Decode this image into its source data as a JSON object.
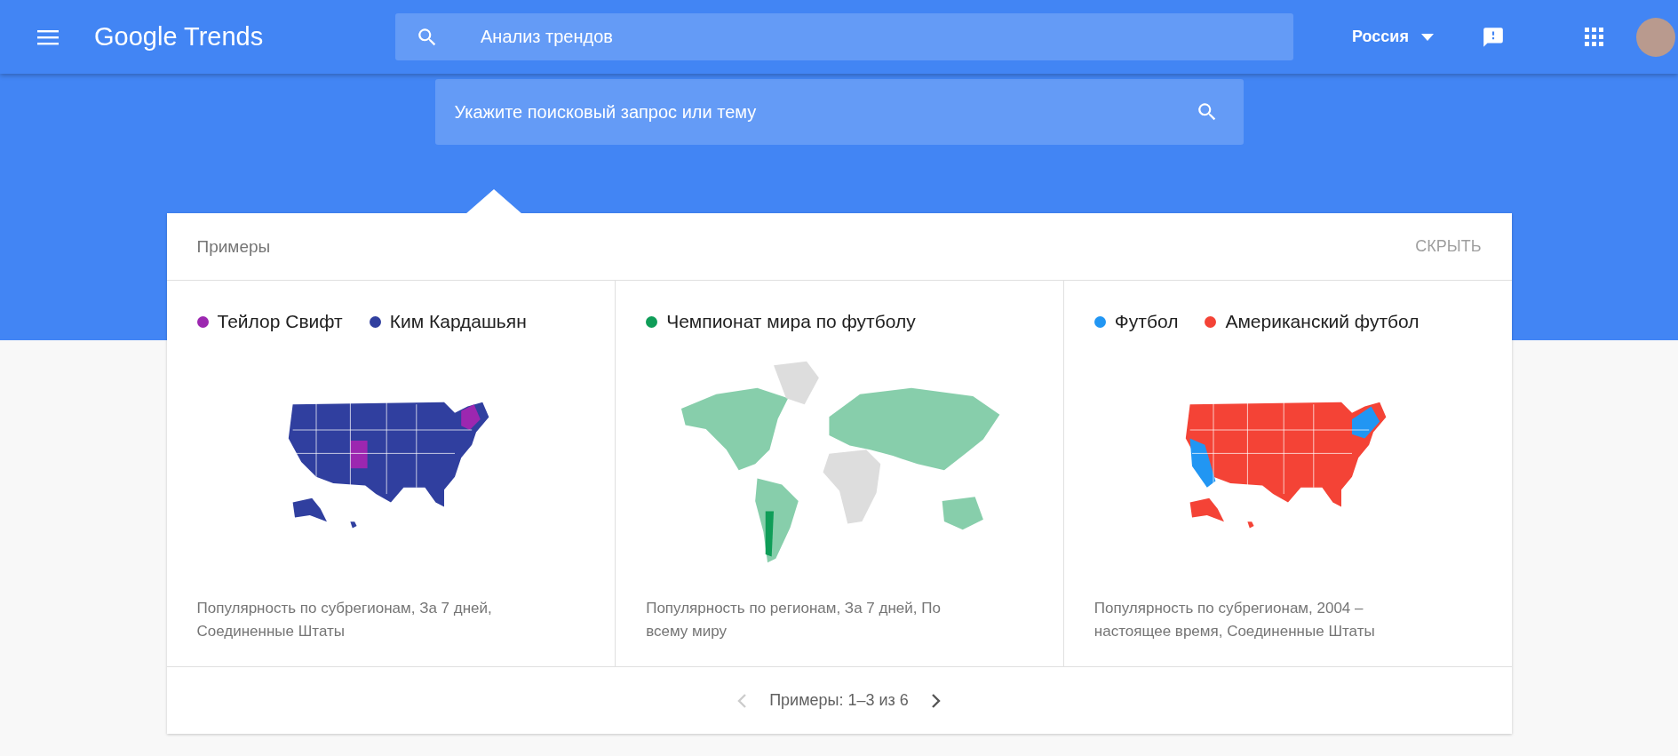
{
  "header": {
    "logo": "Google Trends",
    "search": {
      "placeholder": "Анализ трендов"
    },
    "region": "Россия"
  },
  "hero_search": {
    "placeholder": "Укажите поисковый запрос или тему"
  },
  "examples_panel": {
    "title": "Примеры",
    "hide_link": "СКРЫТЬ",
    "examples": [
      {
        "kind": "us",
        "terms": [
          {
            "name": "Тейлор Свифт",
            "color": "#9c27b0"
          },
          {
            "name": "Ким Кардашьян",
            "color": "#303f9f"
          }
        ],
        "description": "Популярность по субрегионам, За 7 дней, Соединенные Штаты"
      },
      {
        "kind": "world",
        "terms": [
          {
            "name": "Чемпионат мира по футболу",
            "color": "#0f9d58"
          }
        ],
        "description": "Популярность по регионам, За 7 дней, По всему миру"
      },
      {
        "kind": "us",
        "terms": [
          {
            "name": "Футбол",
            "color": "#2196f3"
          },
          {
            "name": "Американский футбол",
            "color": "#f44336"
          }
        ],
        "description": "Популярность по субрегионам, 2004 – настоящее время, Соединенные Штаты"
      }
    ],
    "pagination": {
      "label": "Примеры: 1–3 из 6",
      "prev_disabled": true,
      "next_disabled": false
    }
  }
}
